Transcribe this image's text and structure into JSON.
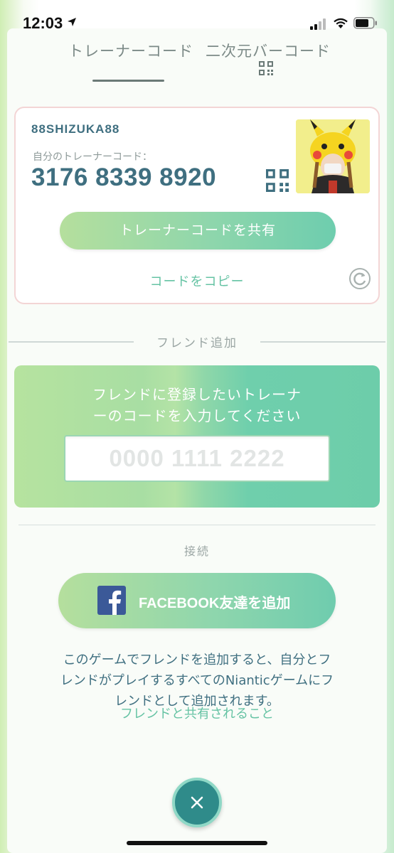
{
  "status_bar": {
    "time": "12:03",
    "icons": [
      "location-arrow-icon",
      "signal-icon",
      "wifi-icon",
      "battery-icon"
    ]
  },
  "tabs": [
    {
      "label": "トレーナーコード",
      "active": true
    },
    {
      "label": "二次元バーコード",
      "active": false,
      "icon": "qr-code-icon"
    }
  ],
  "trainer_card": {
    "name": "88SHIZUKA88",
    "code_label": "自分のトレーナーコード：",
    "code": "3176 8339 8920",
    "share_label": "トレーナーコードを共有",
    "copy_label": "コードをコピー"
  },
  "friend_add": {
    "section_title": "フレンド追加",
    "prompt_line1": "フレンドに登録したいトレーナ",
    "prompt_line2": "ーのコードを入力してください",
    "input_placeholder": "0000 1111 2222",
    "input_value": ""
  },
  "connect": {
    "section_title": "接続",
    "facebook_label": "FACEBOOK友達を追加"
  },
  "info": {
    "line1": "このゲームでフレンドを追加すると、自分とフ",
    "line2": "レンドがプレイするすべてのNianticゲームにフ",
    "line3": "レンドとして追加されます。",
    "link": "フレンドと共有されること"
  },
  "colors": {
    "accent_teal": "#3f6f80",
    "link_green": "#66c3a4",
    "button_gradient_start": "#b5df9d",
    "button_gradient_end": "#6ecdae",
    "facebook_blue": "#3b5998",
    "close_button": "#2f8b8a"
  }
}
